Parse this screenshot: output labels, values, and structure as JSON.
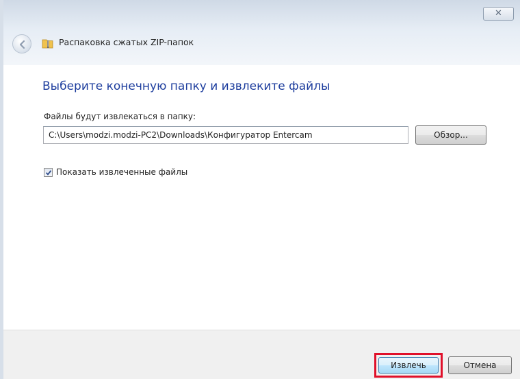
{
  "window": {
    "title": "Распаковка сжатых ZIP-папок",
    "close_glyph": "✕"
  },
  "wizard": {
    "heading": "Выберите конечную папку и извлеките файлы",
    "path_label": "Файлы будут извлекаться в папку:",
    "path_value": "C:\\Users\\modzi.modzi-PC2\\Downloads\\Конфигуратор Entercam",
    "browse_label": "Обзор...",
    "show_files_label": "Показать извлеченные файлы",
    "show_files_checked": true
  },
  "footer": {
    "extract_label": "Извлечь",
    "cancel_label": "Отмена"
  },
  "icons": {
    "back": "back-arrow-icon",
    "zip": "zip-folder-icon",
    "close": "close-icon",
    "check": "checkmark-icon"
  },
  "colors": {
    "heading": "#1e3e9e",
    "highlight": "#e0102a",
    "primary_button": "#bee6fd"
  }
}
